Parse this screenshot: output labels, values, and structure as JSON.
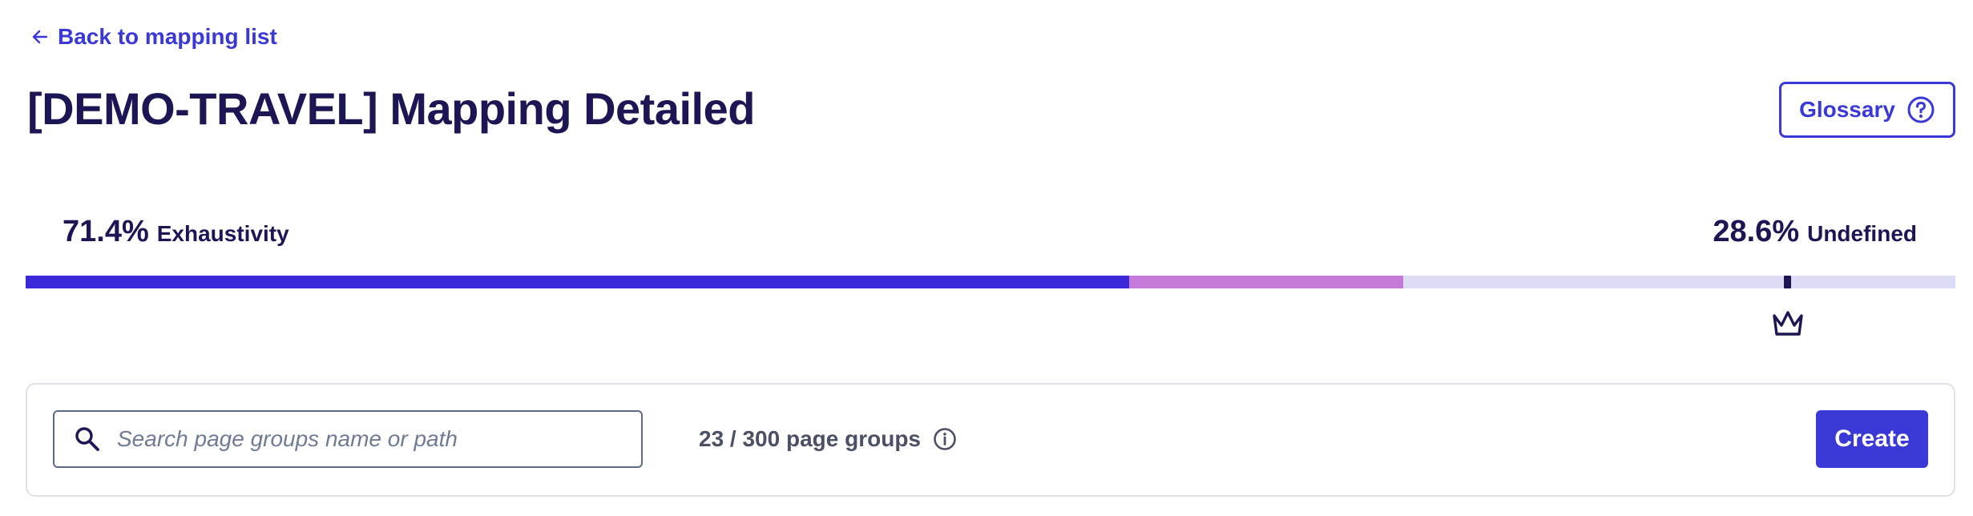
{
  "nav": {
    "back_label": "Back to mapping list",
    "back_icon": "arrow-left-icon"
  },
  "header": {
    "title": "[DEMO-TRAVEL] Mapping Detailed",
    "glossary_label": "Glossary",
    "glossary_icon": "help-circle-icon"
  },
  "stats": {
    "exhaustivity_percent": "71.4%",
    "exhaustivity_label": "Exhaustivity",
    "undefined_percent": "28.6%",
    "undefined_label": "Undefined"
  },
  "progress": {
    "segments": [
      {
        "name": "exhaustivity-main",
        "fraction": 0.572,
        "color": "#3b28d8"
      },
      {
        "name": "exhaustivity-secondary",
        "fraction": 0.142,
        "color": "#c57ad9"
      }
    ],
    "remaining_color": "#dcdcf6",
    "target_fraction": 0.913,
    "target_icon": "crown-icon"
  },
  "toolbar": {
    "search_placeholder": "Search page groups name or path",
    "search_value": "",
    "search_icon": "search-icon",
    "count_text": "23 / 300 page groups",
    "info_icon": "info-icon",
    "create_label": "Create"
  },
  "colors": {
    "accent": "#3b38d8",
    "text_primary": "#1c1654",
    "text_secondary": "#4b5066",
    "bar_primary": "#3b28d8",
    "bar_secondary": "#c57ad9",
    "bar_track": "#dcdcf6"
  }
}
